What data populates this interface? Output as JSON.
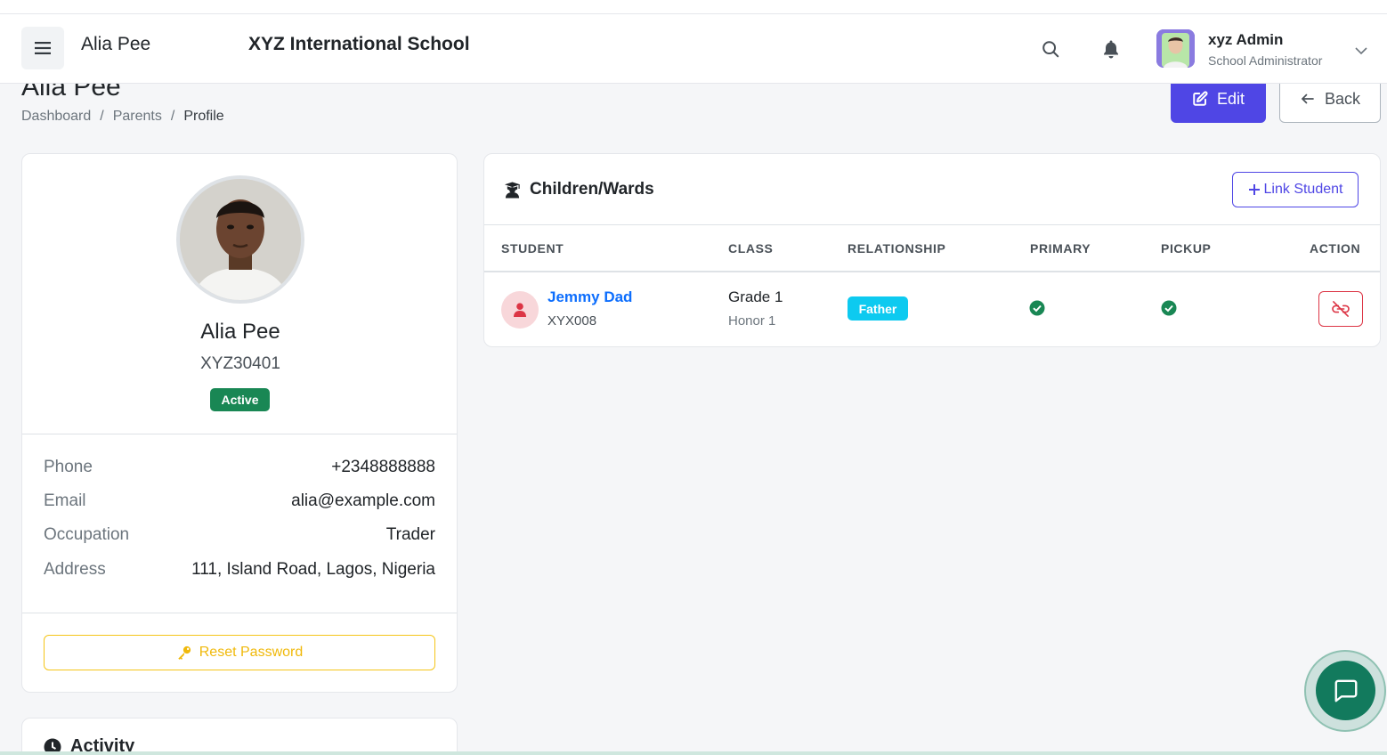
{
  "page": {
    "title": "Alia Pee",
    "breadcrumb": [
      "Dashboard",
      "Parents",
      "Profile"
    ],
    "edit_label": "Edit",
    "back_label": "Back"
  },
  "navbar": {
    "user_name": "Alia Pee",
    "school_name": "XYZ International School",
    "admin_name": "xyz Admin",
    "admin_role": "School Administrator",
    "icons": [
      "menu-icon",
      "search-icon",
      "bell-icon",
      "chevron-down-icon"
    ]
  },
  "profile": {
    "name": "Alia Pee",
    "code": "XYZ30401",
    "status": "Active",
    "fields": [
      {
        "label": "Phone",
        "value": "+2348888888"
      },
      {
        "label": "Email",
        "value": "alia@example.com"
      },
      {
        "label": "Occupation",
        "value": "Trader"
      },
      {
        "label": "Address",
        "value": "111, Island Road, Lagos, Nigeria"
      }
    ],
    "reset_label": "Reset Password"
  },
  "activity": {
    "title": "Activity"
  },
  "children": {
    "title": "Children/Wards",
    "link_label": "Link Student",
    "headers": [
      "STUDENT",
      "CLASS",
      "RELATIONSHIP",
      "PRIMARY",
      "PICKUP",
      "ACTION"
    ],
    "rows": [
      {
        "name": "Jemmy Dad",
        "id": "XYX008",
        "class": "Grade 1",
        "class_sub": "Honor 1",
        "relationship": "Father",
        "primary": true,
        "pickup": true
      }
    ]
  },
  "colors": {
    "primary": "#4f46e5",
    "success": "#198754",
    "info": "#0dcaf0",
    "danger": "#dc3545",
    "warning": "#f0b90b",
    "link": "#0d6efd",
    "chat": "#127a5d"
  }
}
